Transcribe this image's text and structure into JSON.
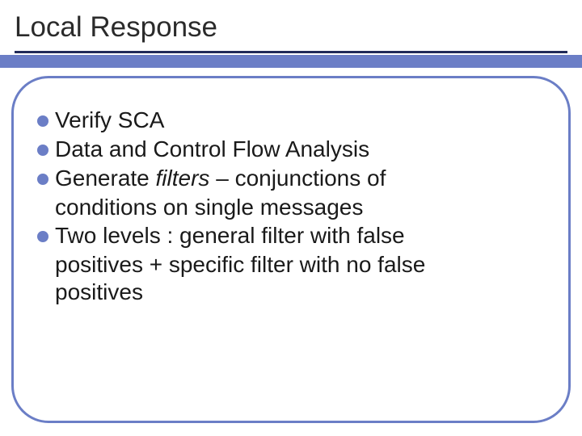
{
  "slide": {
    "title": "Local Response",
    "bullets": [
      {
        "lines": [
          "Verify SCA"
        ]
      },
      {
        "lines": [
          "Data and Control Flow Analysis"
        ]
      },
      {
        "prefix": "Generate ",
        "italic": "filters",
        "suffix": " – conjunctions of",
        "lines_after": [
          "conditions on single messages"
        ]
      },
      {
        "lines": [
          "Two levels : general filter with false",
          "positives + specific filter with no false",
          "positives"
        ]
      }
    ]
  }
}
